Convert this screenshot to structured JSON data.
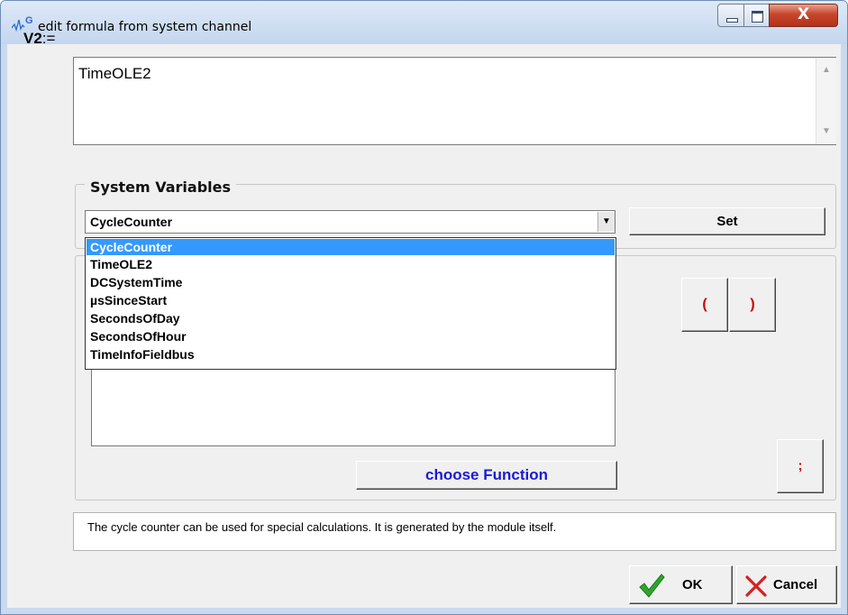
{
  "window": {
    "title": "edit formula from system channel",
    "app_icon_text": "G",
    "close_glyph": "X"
  },
  "formula": {
    "label_bold": "V2",
    "label_rest": ":=",
    "value": "TimeOLE2"
  },
  "system_variables": {
    "legend": "System Variables",
    "selected": "CycleCounter",
    "set_label": "Set",
    "options": [
      "CycleCounter",
      "TimeOLE2",
      "DCSystemTime",
      "µsSinceStart",
      "SecondsOfDay",
      "SecondsOfHour",
      "TimeInfoFieldbus"
    ]
  },
  "functions": {
    "choose_label": "choose Function",
    "open_paren": "(",
    "close_paren": ")",
    "semicolon": ";"
  },
  "description": "The cycle counter can be used for special calculations. It is generated by the module itself.",
  "buttons": {
    "ok": "OK",
    "cancel": "Cancel"
  },
  "colors": {
    "selection": "#3399ff",
    "paren_red": "#d00000",
    "function_blue": "#1a1ad8",
    "ok_check": "#2ea52e",
    "cancel_x": "#d62020"
  },
  "icons": {
    "app": "waveform-g-icon",
    "combo_arrow": "dropdown-arrow-icon",
    "ok": "green-check-icon",
    "cancel": "red-x-icon"
  }
}
